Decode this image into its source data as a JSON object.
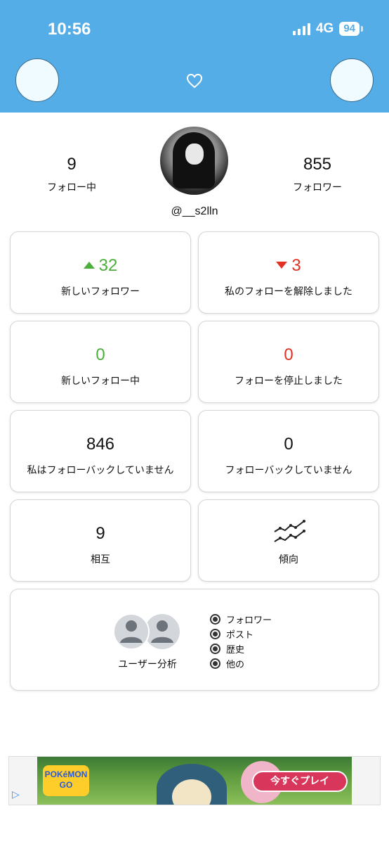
{
  "status_bar": {
    "time": "10:56",
    "network": "4G",
    "battery": "94"
  },
  "profile": {
    "following_count": "9",
    "following_label": "フォロー中",
    "followers_count": "855",
    "followers_label": "フォロワー",
    "username": "@__s2lln"
  },
  "cards": {
    "new_followers": {
      "value": "32",
      "label": "新しいフォロワー",
      "trend": "up"
    },
    "unfollowed_me": {
      "value": "3",
      "label": "私のフォローを解除しました",
      "trend": "down"
    },
    "new_following": {
      "value": "0",
      "label": "新しいフォロー中"
    },
    "stopped_following": {
      "value": "0",
      "label": "フォローを停止しました"
    },
    "not_following_back_me": {
      "value": "846",
      "label": "私はフォローバックしていません"
    },
    "not_following_back": {
      "value": "0",
      "label": "フォローバックしていません"
    },
    "mutual": {
      "value": "9",
      "label": "相互"
    },
    "trends": {
      "label": "傾向"
    }
  },
  "user_analysis": {
    "label": "ユーザー分析",
    "options": [
      "フォロワー",
      "ポスト",
      "歴史",
      "他の"
    ]
  },
  "ad": {
    "logo_line1": "POKéMON",
    "logo_line2": "GO",
    "cta": "今すぐプレイ"
  },
  "colors": {
    "header": "#55ade8",
    "positive": "#4caf3c",
    "negative": "#e13224"
  },
  "icons": [
    "heart-icon",
    "signal-icon",
    "battery-icon",
    "trend-chart-icon",
    "users-icon",
    "ad-choices-icon"
  ]
}
